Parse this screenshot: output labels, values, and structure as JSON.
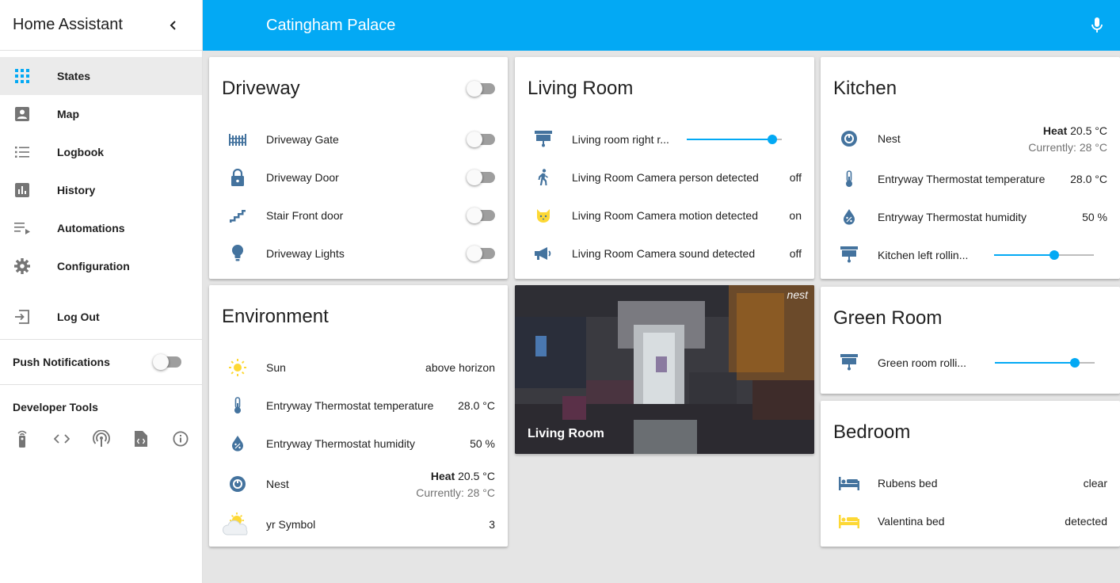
{
  "sidebar": {
    "title": "Home Assistant",
    "items": [
      {
        "label": "States",
        "icon": "view-dashboard-icon"
      },
      {
        "label": "Map",
        "icon": "account-box-icon"
      },
      {
        "label": "Logbook",
        "icon": "format-list-bulleted-icon"
      },
      {
        "label": "History",
        "icon": "chart-box-icon"
      },
      {
        "label": "Automations",
        "icon": "playlist-play-icon"
      },
      {
        "label": "Configuration",
        "icon": "gear-icon"
      }
    ],
    "logout_label": "Log Out",
    "push_label": "Push Notifications",
    "push_enabled": false,
    "dev_tools_title": "Developer Tools"
  },
  "header": {
    "title": "Catingham Palace"
  },
  "cards": {
    "driveway": {
      "title": "Driveway",
      "rows": [
        {
          "name": "Driveway Gate",
          "state": "off"
        },
        {
          "name": "Driveway Door",
          "state": "off"
        },
        {
          "name": "Stair Front door",
          "state": "off"
        },
        {
          "name": "Driveway Lights",
          "state": "off"
        }
      ]
    },
    "living_room": {
      "title": "Living Room",
      "rows": [
        {
          "name": "Living room right r...",
          "position": 0.9
        },
        {
          "name": "Living Room Camera person detected",
          "value": "off"
        },
        {
          "name": "Living Room Camera motion detected",
          "value": "on"
        },
        {
          "name": "Living Room Camera sound detected",
          "value": "off"
        }
      ]
    },
    "kitchen": {
      "title": "Kitchen",
      "rows": [
        {
          "name": "Nest",
          "mode": "Heat",
          "target": "20.5 °C",
          "current": "Currently: 28 °C"
        },
        {
          "name": "Entryway Thermostat temperature",
          "value": "28.0 °C"
        },
        {
          "name": "Entryway Thermostat humidity",
          "value": "50 %"
        },
        {
          "name": "Kitchen left rollin...",
          "position": 0.6
        }
      ]
    },
    "environment": {
      "title": "Environment",
      "rows": [
        {
          "name": "Sun",
          "value": "above horizon"
        },
        {
          "name": "Entryway Thermostat temperature",
          "value": "28.0 °C"
        },
        {
          "name": "Entryway Thermostat humidity",
          "value": "50 %"
        },
        {
          "name": "Nest",
          "mode": "Heat",
          "target": "20.5 °C",
          "current": "Currently: 28 °C"
        },
        {
          "name": "yr Symbol",
          "value": "3"
        }
      ]
    },
    "camera": {
      "label": "Living Room",
      "logo": "nest"
    },
    "green_room": {
      "title": "Green Room",
      "rows": [
        {
          "name": "Green room rolli...",
          "position": 0.8
        }
      ]
    },
    "bedroom": {
      "title": "Bedroom",
      "rows": [
        {
          "name": "Rubens bed",
          "value": "clear"
        },
        {
          "name": "Valentina bed",
          "value": "detected"
        }
      ]
    }
  },
  "colors": {
    "primary": "#03a9f4",
    "icon": "#44739e",
    "icon_active": "#fdd835",
    "sidebar_active_bg": "#ebebeb",
    "background": "#e5e5e5"
  }
}
